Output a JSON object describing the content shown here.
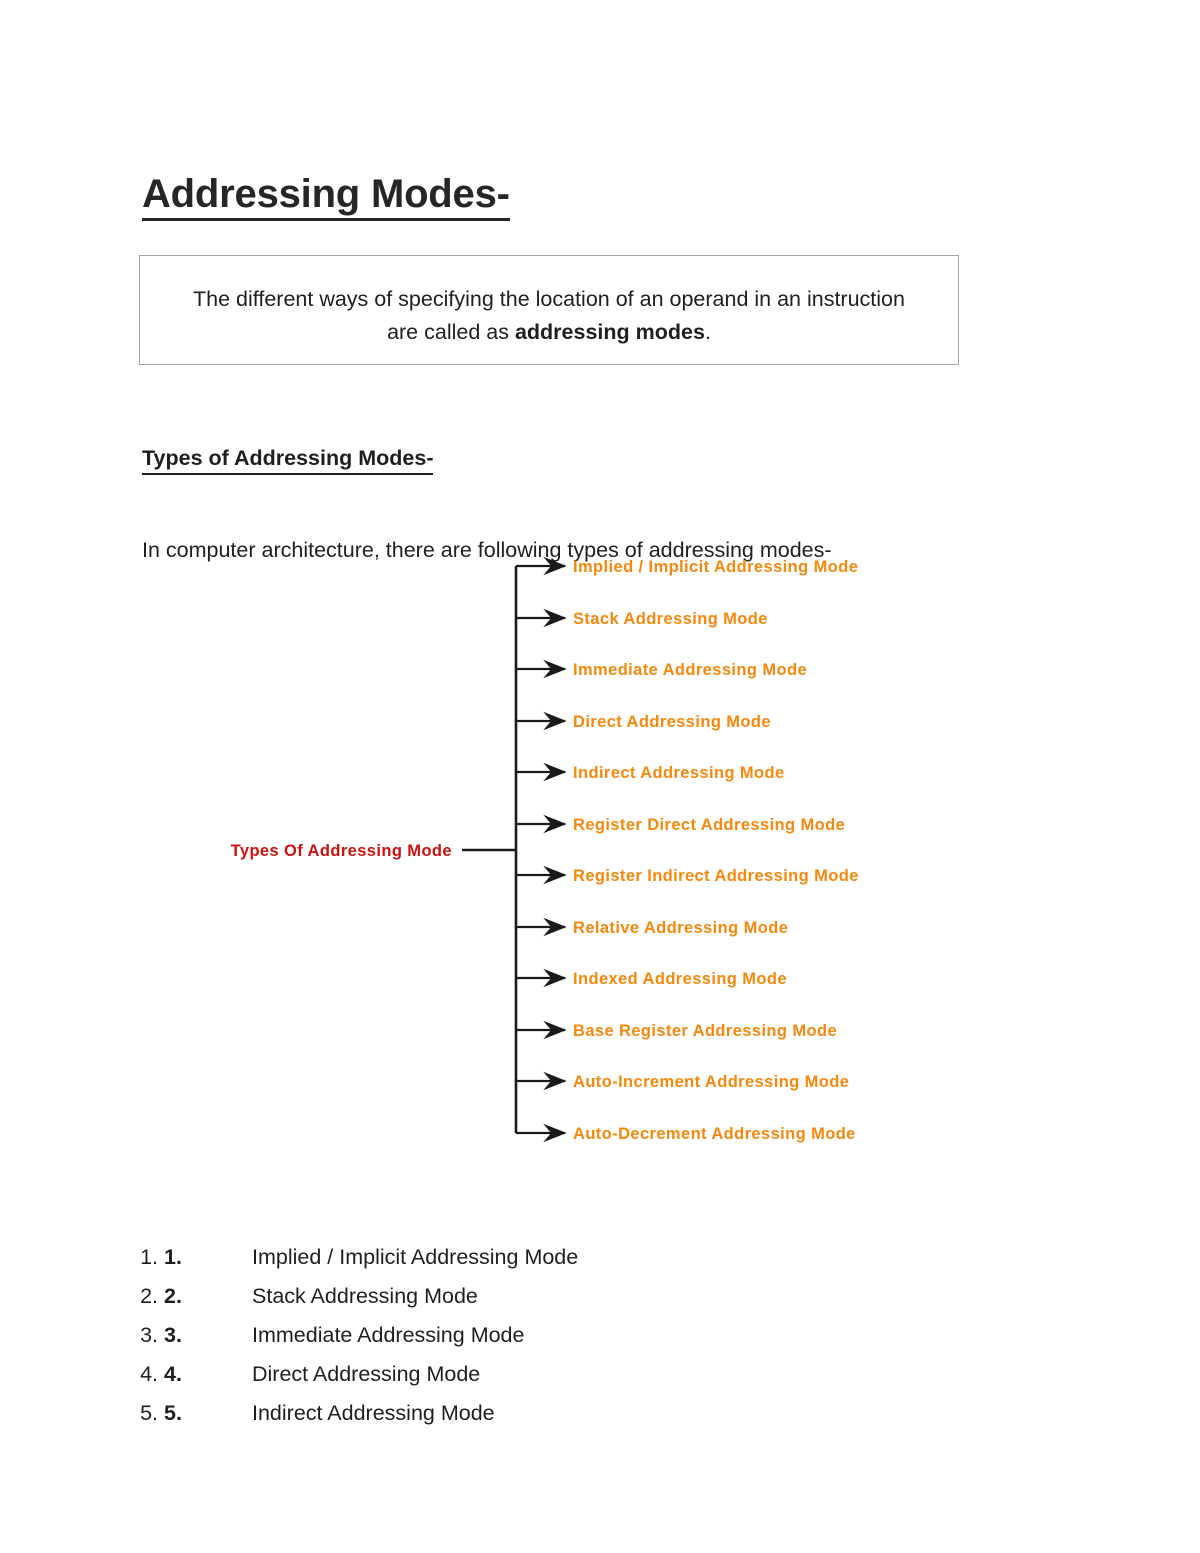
{
  "document": {
    "title": "Addressing Modes-",
    "callout": {
      "lead": "The different ways of specifying the location of an operand in an instruction are called as ",
      "emphasis": "addressing modes",
      "trail": "."
    },
    "section_heading": "Types of Addressing Modes-",
    "intro": "In computer architecture, there are following types of addressing modes-"
  },
  "diagram": {
    "root_label": "Types Of Addressing Mode",
    "root_color": "#cc1111",
    "branch_color": "#f5880d",
    "line_color": "#1a1a1a",
    "branches": [
      "Implied / Implicit Addressing Mode",
      "Stack Addressing Mode",
      "Immediate Addressing Mode",
      "Direct Addressing Mode",
      "Indirect Addressing Mode",
      "Register Direct Addressing Mode",
      "Register Indirect Addressing Mode",
      "Relative Addressing Mode",
      "Indexed Addressing Mode",
      "Base Register Addressing Mode",
      "Auto-Increment Addressing Mode",
      "Auto-Decrement Addressing Mode"
    ]
  },
  "mode_list": [
    {
      "num": "1.",
      "label": "Implied / Implicit Addressing Mode"
    },
    {
      "num": "2.",
      "label": "Stack Addressing Mode"
    },
    {
      "num": "3.",
      "label": "Immediate Addressing Mode"
    },
    {
      "num": "4.",
      "label": "Direct Addressing Mode"
    },
    {
      "num": "5.",
      "label": "Indirect Addressing Mode"
    }
  ]
}
